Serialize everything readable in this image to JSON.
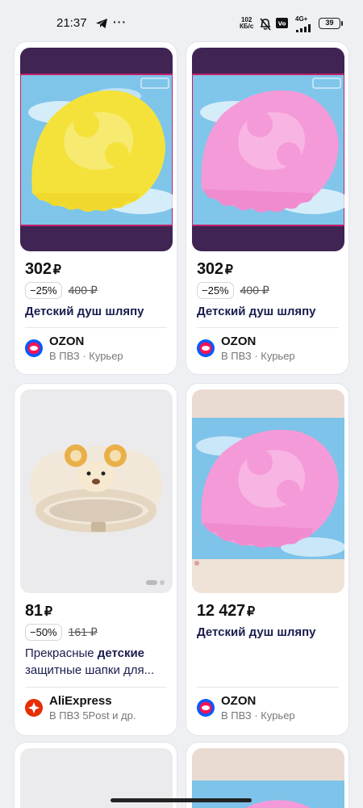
{
  "status_bar": {
    "time": "21:37",
    "speed_value": "102",
    "speed_unit": "КБ/с",
    "network": "4G+",
    "battery": "39"
  },
  "products": [
    {
      "price": "302",
      "currency": "₽",
      "discount": "−25%",
      "old_price": "400 ₽",
      "title": "Детский душ шляпу",
      "seller": "OZON",
      "delivery": "В ПВЗ · Курьер",
      "image_color": "yellow"
    },
    {
      "price": "302",
      "currency": "₽",
      "discount": "−25%",
      "old_price": "400 ₽",
      "title": "Детский душ шляпу",
      "seller": "OZON",
      "delivery": "В ПВЗ · Курьер",
      "image_color": "pink"
    },
    {
      "price": "81",
      "currency": "₽",
      "discount": "−50%",
      "old_price": "161 ₽",
      "title_plain": "Прекрасные ",
      "title_bold": "детские",
      "title_rest": " защитные шапки для...",
      "seller": "AliExpress",
      "delivery": "В ПВЗ 5Post и др.",
      "image_color": "cream-bear"
    },
    {
      "price": "12 427",
      "currency": "₽",
      "title": "Детский душ шляпу",
      "seller": "OZON",
      "delivery": "В ПВЗ · Курьер",
      "image_color": "pink"
    }
  ],
  "colors": {
    "ozon_blue": "#005bff",
    "ozon_red": "#f91155",
    "aliexpress_red": "#e62e04",
    "title_navy": "#1a1c4e",
    "card_frame_purple": "#3f2454"
  }
}
